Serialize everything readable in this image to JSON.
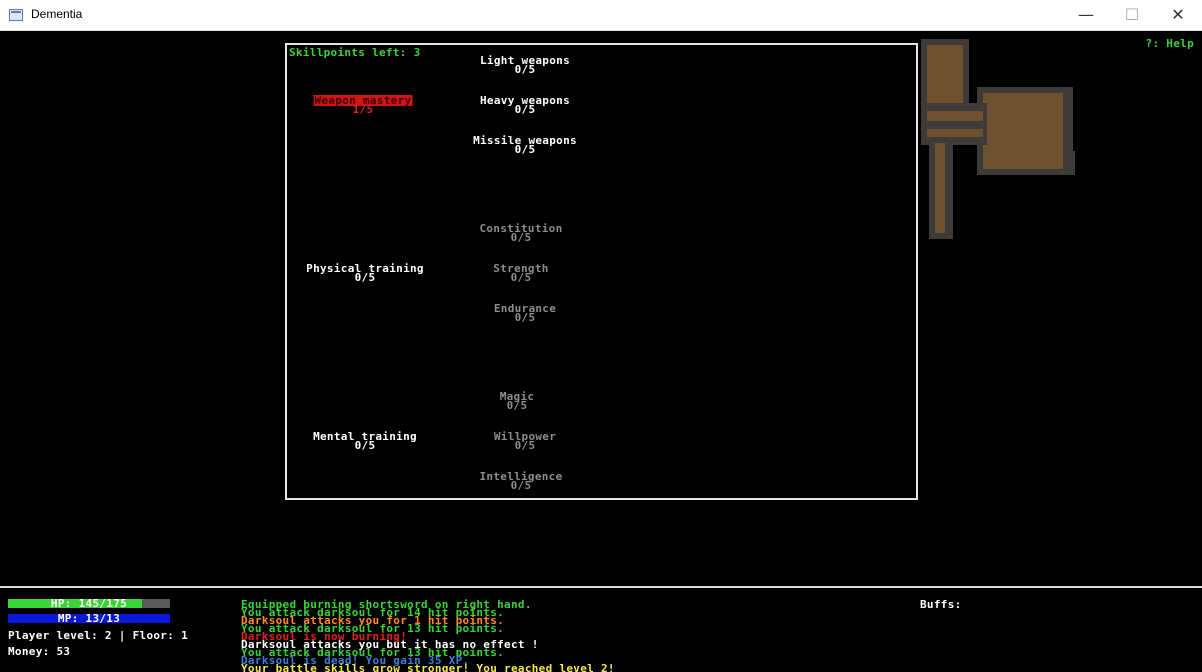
{
  "window": {
    "title": "Dementia",
    "minimize": "—",
    "maximize": "☐",
    "close": "✕"
  },
  "help": "?: Help",
  "panel": {
    "skillpoints_label": "Skillpoints left: 3",
    "skills": [
      {
        "name": "Light weapons",
        "level": "0/5",
        "state": "available"
      },
      {
        "name": "Weapon mastery",
        "level": "1/5",
        "state": "selected"
      },
      {
        "name": "Heavy weapons",
        "level": "0/5",
        "state": "available"
      },
      {
        "name": "Missile weapons",
        "level": "0/5",
        "state": "available"
      },
      {
        "name": "Constitution",
        "level": "0/5",
        "state": "locked"
      },
      {
        "name": "Physical training",
        "level": "0/5",
        "state": "available"
      },
      {
        "name": "Strength",
        "level": "0/5",
        "state": "locked"
      },
      {
        "name": "Endurance",
        "level": "0/5",
        "state": "locked"
      },
      {
        "name": "Magic",
        "level": "0/5",
        "state": "locked"
      },
      {
        "name": "Mental training",
        "level": "0/5",
        "state": "available"
      },
      {
        "name": "Willpower",
        "level": "0/5",
        "state": "locked"
      },
      {
        "name": "Intelligence",
        "level": "0/5",
        "state": "locked"
      }
    ]
  },
  "hud": {
    "hp_text": "HP: 145/175",
    "hp_fraction": 0.83,
    "mp_text": "MP: 13/13",
    "mp_fraction": 1.0,
    "level_floor": "Player level: 2 | Floor: 1",
    "money": "Money: 53",
    "buffs_label": "Buffs:",
    "log": [
      {
        "text": "Equipped burning shortsword on right hand.",
        "color": "#39d437"
      },
      {
        "text": "You attack darksoul for 14 hit points.",
        "color": "#39d437"
      },
      {
        "text": "Darksoul attacks you for 1 hit points.",
        "color": "#ff8a2a"
      },
      {
        "text": "You attack darksoul for 13 hit points.",
        "color": "#39d437"
      },
      {
        "text": "Darksoul is now burning!",
        "color": "#e02020"
      },
      {
        "text": "Darksoul attacks you but it has no effect !",
        "color": "#ffffff"
      },
      {
        "text": "You attack darksoul for 13 hit points.",
        "color": "#39d437"
      },
      {
        "text": "Darksoul is dead! You gain 35 XP.",
        "color": "#3a7fd9"
      },
      {
        "text": "Your battle skills grow stronger! You reached level 2!",
        "color": "#f5e84a"
      }
    ]
  }
}
